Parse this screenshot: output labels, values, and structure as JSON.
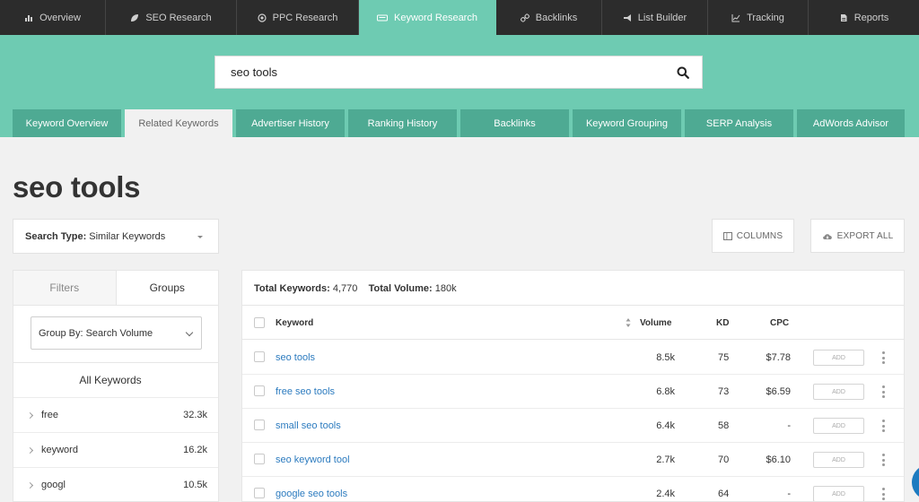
{
  "top_nav": [
    {
      "label": "Overview",
      "icon": "bar-chart-icon"
    },
    {
      "label": "SEO Research",
      "icon": "leaf-icon"
    },
    {
      "label": "PPC Research",
      "icon": "target-icon"
    },
    {
      "label": "Keyword Research",
      "icon": "keyboard-icon",
      "active": true
    },
    {
      "label": "Backlinks",
      "icon": "link-icon"
    },
    {
      "label": "List Builder",
      "icon": "megaphone-icon"
    },
    {
      "label": "Tracking",
      "icon": "line-chart-icon"
    },
    {
      "label": "Reports",
      "icon": "document-icon"
    }
  ],
  "search": {
    "value": "seo tools",
    "icon": "search-icon"
  },
  "sub_tabs": [
    {
      "label": "Keyword Overview"
    },
    {
      "label": "Related Keywords",
      "active": true
    },
    {
      "label": "Advertiser History"
    },
    {
      "label": "Ranking History"
    },
    {
      "label": "Backlinks"
    },
    {
      "label": "Keyword Grouping"
    },
    {
      "label": "SERP Analysis"
    },
    {
      "label": "AdWords Advisor"
    }
  ],
  "page_title": "seo tools",
  "search_type": {
    "label": "Search Type:",
    "value": "Similar Keywords"
  },
  "buttons": {
    "columns": "COLUMNS",
    "export": "EXPORT ALL"
  },
  "left_panel": {
    "tabs": [
      "Filters",
      "Groups"
    ],
    "active_tab": "Groups",
    "group_by": "Group By: Search Volume",
    "all_keywords": "All Keywords",
    "groups": [
      {
        "name": "free",
        "count": "32.3k"
      },
      {
        "name": "keyword",
        "count": "16.2k"
      },
      {
        "name": "googl",
        "count": "10.5k"
      }
    ]
  },
  "table": {
    "totals": {
      "kw_label": "Total Keywords:",
      "kw_value": "4,770",
      "vol_label": "Total Volume:",
      "vol_value": "180k"
    },
    "columns": {
      "keyword": "Keyword",
      "volume": "Volume",
      "kd": "KD",
      "cpc": "CPC"
    },
    "add_label": "ADD",
    "rows": [
      {
        "keyword": "seo tools",
        "volume": "8.5k",
        "kd": "75",
        "cpc": "$7.78"
      },
      {
        "keyword": "free seo tools",
        "volume": "6.8k",
        "kd": "73",
        "cpc": "$6.59"
      },
      {
        "keyword": "small seo tools",
        "volume": "6.4k",
        "kd": "58",
        "cpc": "-"
      },
      {
        "keyword": "seo keyword tool",
        "volume": "2.7k",
        "kd": "70",
        "cpc": "$6.10"
      },
      {
        "keyword": "google seo tools",
        "volume": "2.4k",
        "kd": "64",
        "cpc": "-"
      }
    ]
  },
  "colors": {
    "accent": "#6ecbb2",
    "tab_inactive": "#4eaa93",
    "nav_bg": "#2c2c2c",
    "link": "#2c7bbf"
  }
}
